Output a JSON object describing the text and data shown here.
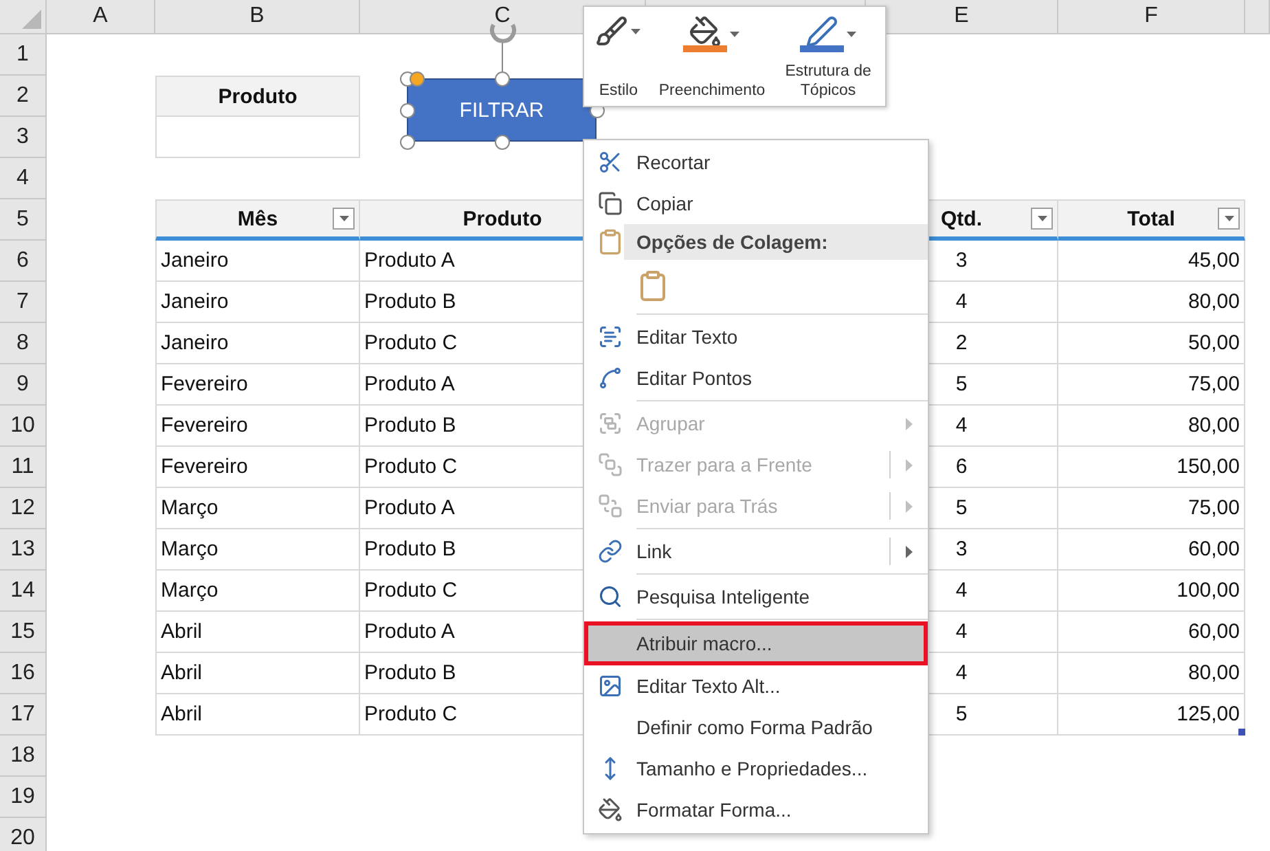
{
  "sheet": {
    "columns": [
      "A",
      "B",
      "C",
      "E",
      "F"
    ],
    "rows": [
      "1",
      "2",
      "3",
      "4",
      "5",
      "6",
      "7",
      "8",
      "9",
      "10",
      "11",
      "12",
      "13",
      "14",
      "15",
      "16",
      "17",
      "18",
      "19",
      "20"
    ]
  },
  "filter_box": {
    "label": "Produto"
  },
  "table": {
    "columns": [
      {
        "label": "Mês",
        "filter_button": true
      },
      {
        "label": "Produto",
        "filter_button": false
      },
      {
        "label": "Qtd.",
        "filter_button": true
      },
      {
        "label": "Total",
        "filter_button": true
      }
    ],
    "rows": [
      [
        "Janeiro",
        "Produto A",
        "3",
        "45,00"
      ],
      [
        "Janeiro",
        "Produto B",
        "4",
        "80,00"
      ],
      [
        "Janeiro",
        "Produto C",
        "2",
        "50,00"
      ],
      [
        "Fevereiro",
        "Produto A",
        "5",
        "75,00"
      ],
      [
        "Fevereiro",
        "Produto B",
        "4",
        "80,00"
      ],
      [
        "Fevereiro",
        "Produto C",
        "6",
        "150,00"
      ],
      [
        "Março",
        "Produto A",
        "5",
        "75,00"
      ],
      [
        "Março",
        "Produto B",
        "3",
        "60,00"
      ],
      [
        "Março",
        "Produto C",
        "4",
        "100,00"
      ],
      [
        "Abril",
        "Produto A",
        "4",
        "60,00"
      ],
      [
        "Abril",
        "Produto B",
        "4",
        "80,00"
      ],
      [
        "Abril",
        "Produto C",
        "5",
        "125,00"
      ]
    ]
  },
  "shape": {
    "label": "FILTRAR",
    "selected": true
  },
  "mini_toolbar": [
    {
      "label": "Estilo"
    },
    {
      "label": "Preenchimento",
      "color": "#ed7d31"
    },
    {
      "label": "Estrutura de Tópicos",
      "color": "#4472c4"
    }
  ],
  "context_menu": [
    {
      "kind": "item",
      "label": "Recortar",
      "disabled": false,
      "submenu": false,
      "split": false,
      "selected": false
    },
    {
      "kind": "item",
      "label": "Copiar",
      "disabled": false,
      "submenu": false,
      "split": false,
      "selected": false
    },
    {
      "kind": "header",
      "label": "Opções de Colagem:"
    },
    {
      "kind": "paste_options"
    },
    {
      "kind": "separator"
    },
    {
      "kind": "item",
      "label": "Editar Texto",
      "disabled": false,
      "submenu": false,
      "split": false,
      "selected": false
    },
    {
      "kind": "item",
      "label": "Editar Pontos",
      "disabled": false,
      "submenu": false,
      "split": false,
      "selected": false
    },
    {
      "kind": "separator"
    },
    {
      "kind": "item",
      "label": "Agrupar",
      "disabled": true,
      "submenu": true,
      "split": false,
      "selected": false
    },
    {
      "kind": "item",
      "label": "Trazer para a Frente",
      "disabled": true,
      "submenu": true,
      "split": true,
      "selected": false
    },
    {
      "kind": "item",
      "label": "Enviar para Trás",
      "disabled": true,
      "submenu": true,
      "split": true,
      "selected": false
    },
    {
      "kind": "separator"
    },
    {
      "kind": "item",
      "label": "Link",
      "disabled": false,
      "submenu": true,
      "split": true,
      "selected": false
    },
    {
      "kind": "separator"
    },
    {
      "kind": "item",
      "label": "Pesquisa Inteligente",
      "disabled": false,
      "submenu": false,
      "split": false,
      "selected": false
    },
    {
      "kind": "separator"
    },
    {
      "kind": "item",
      "label": "Atribuir macro...",
      "disabled": false,
      "submenu": false,
      "split": false,
      "selected": true
    },
    {
      "kind": "item",
      "label": "Editar Texto Alt...",
      "disabled": false,
      "submenu": false,
      "split": false,
      "selected": false
    },
    {
      "kind": "item",
      "label": "Definir como Forma Padrão",
      "disabled": false,
      "submenu": false,
      "split": false,
      "selected": false
    },
    {
      "kind": "item",
      "label": "Tamanho e Propriedades...",
      "disabled": false,
      "submenu": false,
      "split": false,
      "selected": false
    },
    {
      "kind": "item",
      "label": "Formatar Forma...",
      "disabled": false,
      "submenu": false,
      "split": false,
      "selected": false
    }
  ]
}
